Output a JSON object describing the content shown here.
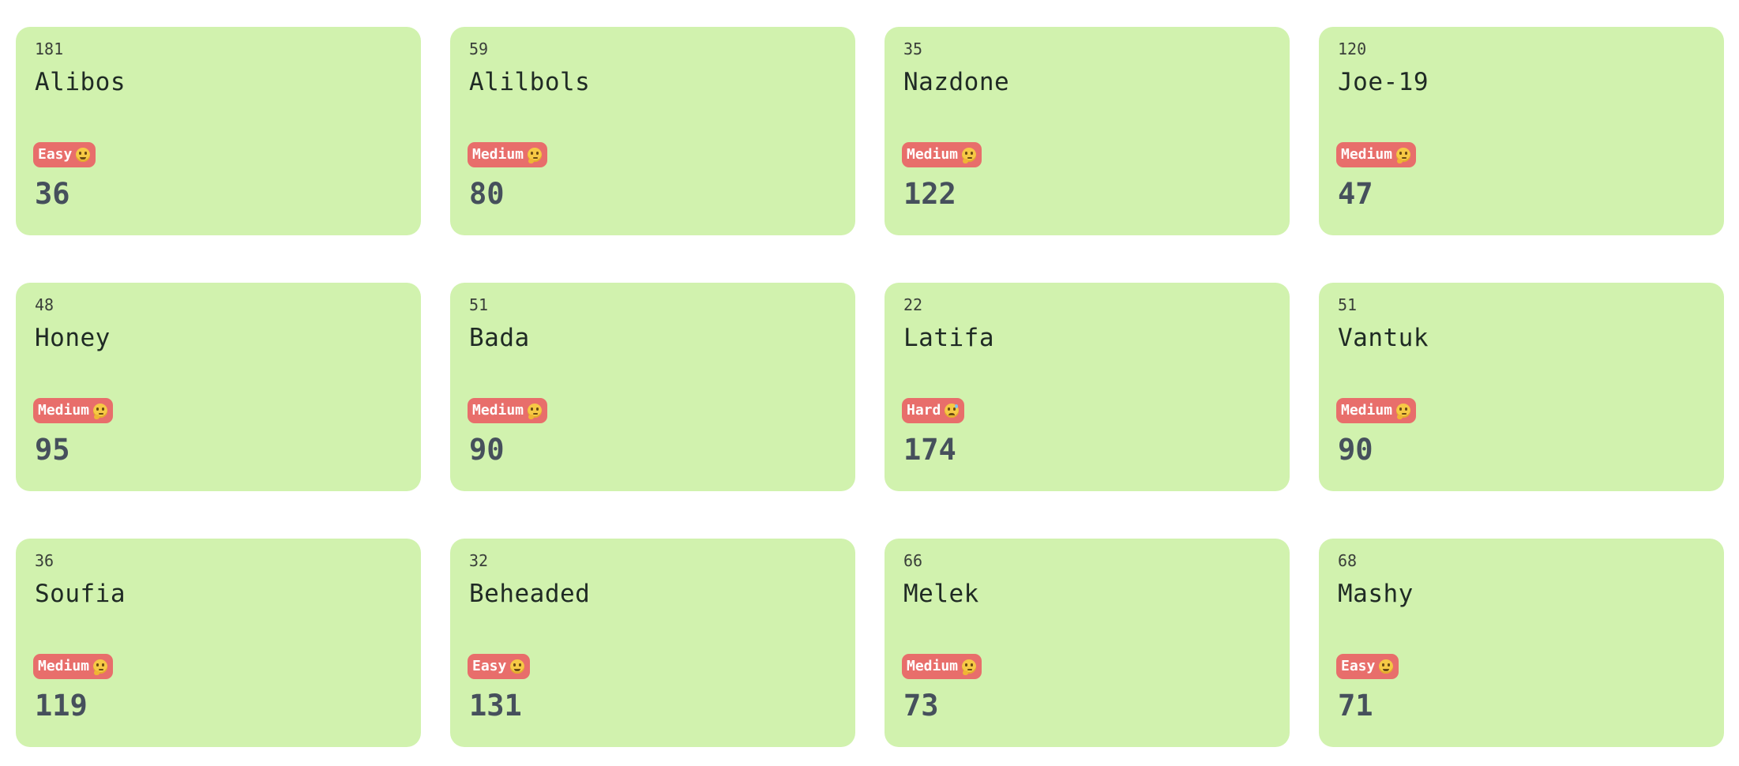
{
  "cards": [
    {
      "id": "181",
      "name": "Alibos",
      "difficulty": "Easy",
      "emoji": "grin-icon",
      "score": "36"
    },
    {
      "id": "59",
      "name": "Alilbols",
      "difficulty": "Medium",
      "emoji": "thinking-icon",
      "score": "80"
    },
    {
      "id": "35",
      "name": "Nazdone",
      "difficulty": "Medium",
      "emoji": "thinking-icon",
      "score": "122"
    },
    {
      "id": "120",
      "name": "Joe-19",
      "difficulty": "Medium",
      "emoji": "thinking-icon",
      "score": "47"
    },
    {
      "id": "48",
      "name": "Honey",
      "difficulty": "Medium",
      "emoji": "thinking-icon",
      "score": "95"
    },
    {
      "id": "51",
      "name": "Bada",
      "difficulty": "Medium",
      "emoji": "thinking-icon",
      "score": "90"
    },
    {
      "id": "22",
      "name": "Latifa",
      "difficulty": "Hard",
      "emoji": "sweat-icon",
      "score": "174"
    },
    {
      "id": "51",
      "name": "Vantuk",
      "difficulty": "Medium",
      "emoji": "thinking-icon",
      "score": "90"
    },
    {
      "id": "36",
      "name": "Soufia",
      "difficulty": "Medium",
      "emoji": "thinking-icon",
      "score": "119"
    },
    {
      "id": "32",
      "name": "Beheaded",
      "difficulty": "Easy",
      "emoji": "grin-icon",
      "score": "131"
    },
    {
      "id": "66",
      "name": "Melek",
      "difficulty": "Medium",
      "emoji": "thinking-icon",
      "score": "73"
    },
    {
      "id": "68",
      "name": "Mashy",
      "difficulty": "Easy",
      "emoji": "grin-icon",
      "score": "71"
    }
  ],
  "colors": {
    "card_background": "#d1f2ae",
    "badge_background": "#e86e6b",
    "badge_text": "#ffffff",
    "score_text": "#46505c"
  }
}
